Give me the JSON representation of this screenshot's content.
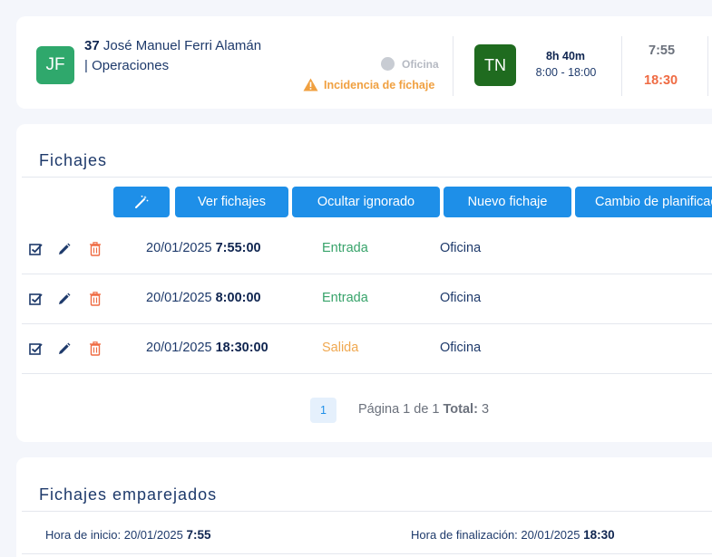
{
  "employee": {
    "initials": "JF",
    "number": "37",
    "name": "José Manuel Ferri Alamán",
    "department": "| Operaciones",
    "location_status": "Oficina",
    "incident": "Incidencia de fichaje",
    "colors": {
      "avatar": "#2fa86c",
      "incident": "#f0a040"
    }
  },
  "shift": {
    "code": "TN",
    "hours": "8h 40m",
    "range": "8:00 - 18:00",
    "time_in": "7:55",
    "time_out": "18:30",
    "colors": {
      "avatar": "#1f6b1f",
      "time_out": "#ef6b43"
    }
  },
  "fichajes": {
    "title": "Fichajes",
    "toolbar": {
      "magic_icon": "magic-wand-icon",
      "ver": "Ver fichajes",
      "ocultar": "Ocultar ignorado",
      "nuevo": "Nuevo fichaje",
      "cambio": "Cambio de planificación"
    },
    "rows": [
      {
        "date": "20/01/2025",
        "time": "7:55:00",
        "type": "Entrada",
        "location": "Oficina"
      },
      {
        "date": "20/01/2025",
        "time": "8:00:00",
        "type": "Entrada",
        "location": "Oficina"
      },
      {
        "date": "20/01/2025",
        "time": "18:30:00",
        "type": "Salida",
        "location": "Oficina"
      }
    ],
    "pagination": {
      "current": "1",
      "page_text": "Página 1 de 1",
      "total_label": "Total:",
      "total": "3"
    }
  },
  "emparejados": {
    "title": "Fichajes emparejados",
    "start_label": "Hora de inicio:",
    "start_date": "20/01/2025",
    "start_time": "7:55",
    "end_label": "Hora de finalización:",
    "end_date": "20/01/2025",
    "end_time": "18:30"
  },
  "accent_color": "#1e8fe8"
}
